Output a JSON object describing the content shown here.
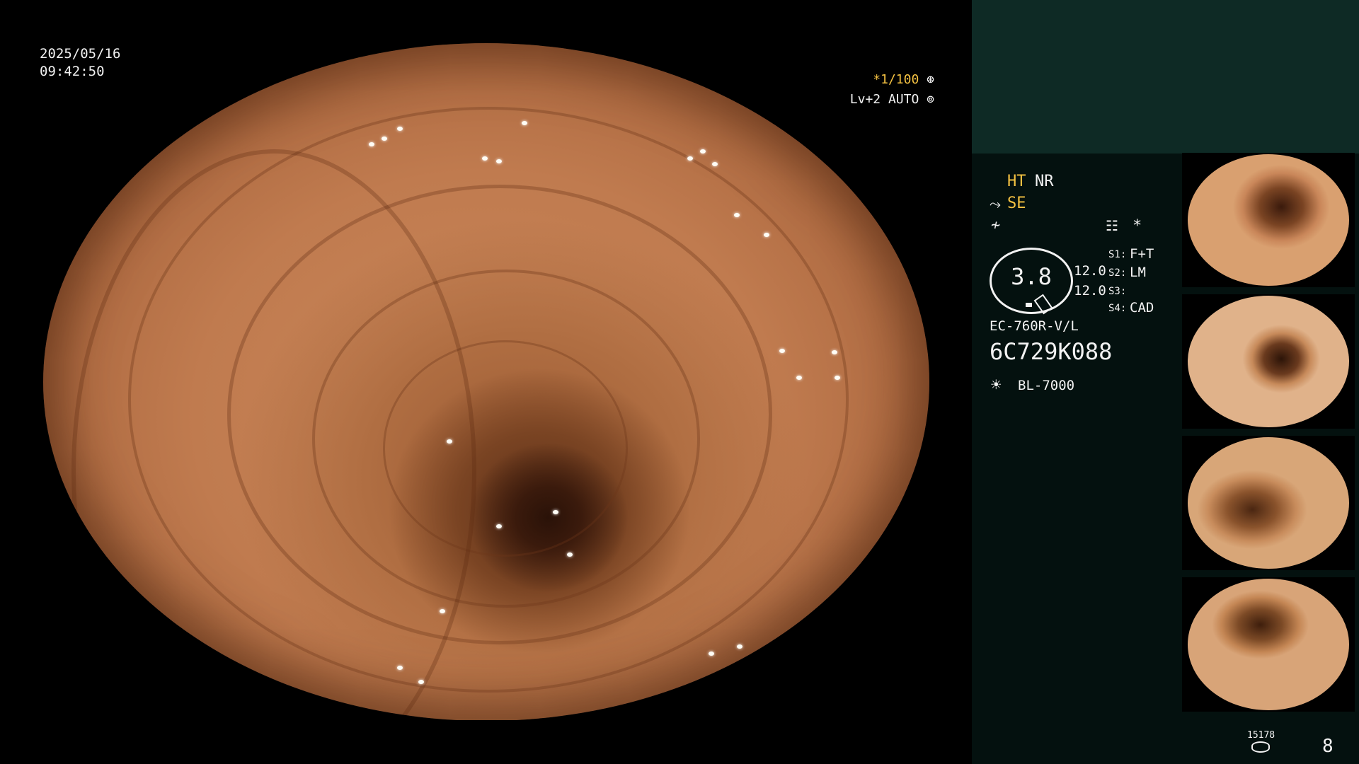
{
  "overlay": {
    "date": "2025/05/16",
    "time": "09:42:50",
    "shutter": "*1/100",
    "level": "Lv+2 AUTO"
  },
  "panel": {
    "ht": "HT",
    "nr": "NR",
    "se": "SE",
    "asterisk": "*",
    "gauge_value": "3.8",
    "gauge_a": "12.0",
    "gauge_b": "12.0",
    "s1_label": "S1:",
    "s1_value": "F+T",
    "s2_label": "S2:",
    "s2_value": "LM",
    "s3_label": "S3:",
    "s3_value": "",
    "s4_label": "S4:",
    "s4_value": "CAD",
    "scope_model": "EC-760R-V/L",
    "serial": "6C729K088",
    "light_source": "BL-7000",
    "image_counter": "15178",
    "page_number": "8"
  },
  "icons": {
    "shutter_icon": "aperture-icon",
    "level_icon": "auto-iris-icon",
    "se_icon": "scope-tip-icon",
    "signal_icon": "signal-icon",
    "memo_icon": "document-icon",
    "light_icon": "lamp-icon",
    "storage_icon": "database-icon"
  },
  "colors": {
    "accent_yellow": "#f5c242",
    "panel_top": "#0e2a25",
    "panel_bg": "#04110f"
  }
}
